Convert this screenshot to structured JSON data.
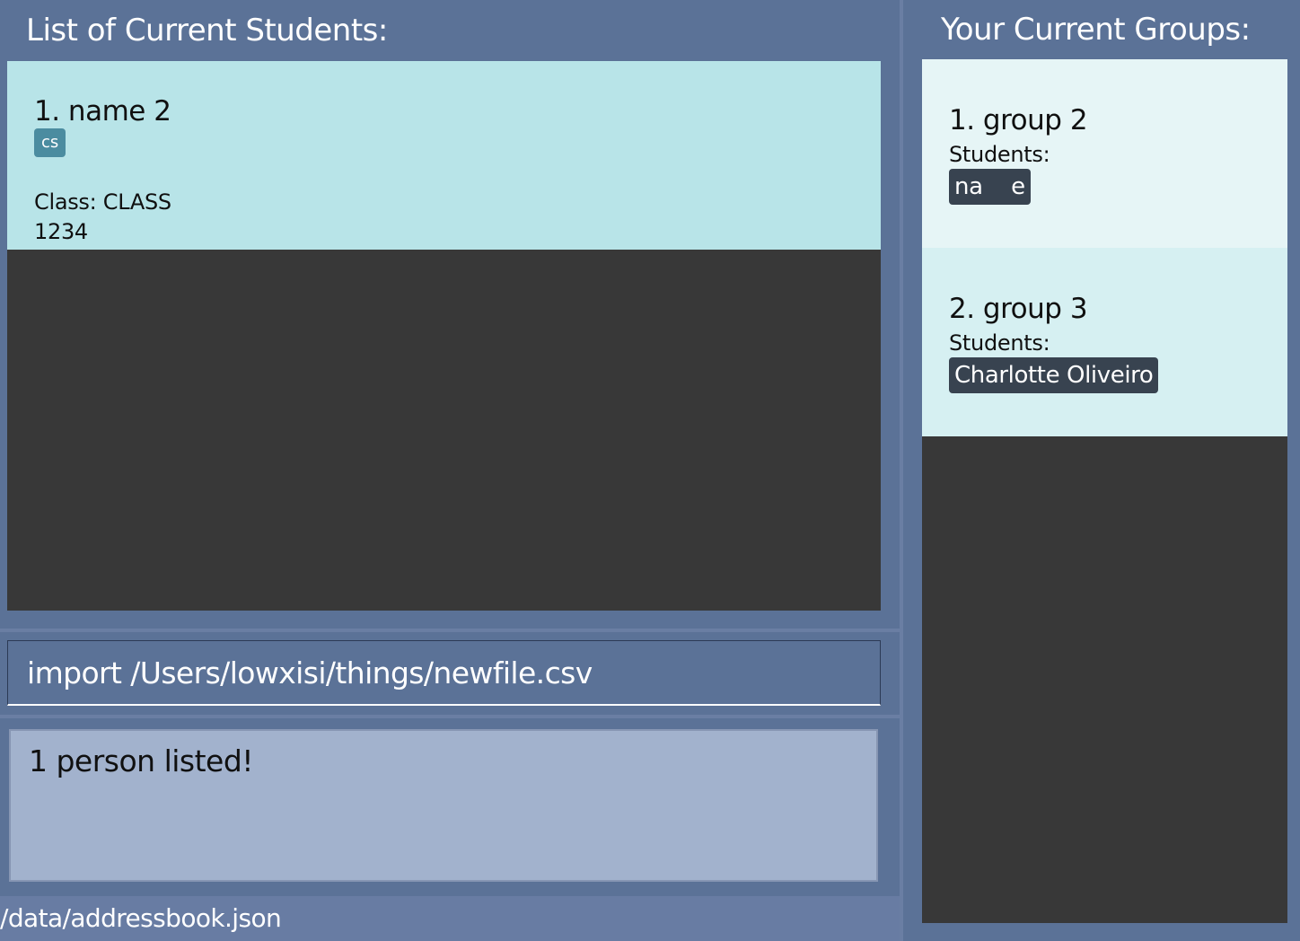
{
  "students_panel": {
    "title": "List of Current Students:",
    "students": [
      {
        "name": "1. name 2",
        "tags": [
          "cs"
        ],
        "phone": "1234",
        "class": "Class: CLASS"
      }
    ]
  },
  "groups_panel": {
    "title": "Your Current Groups:",
    "groups": [
      {
        "name": "1. group 2",
        "students_label": "Students:",
        "members": [
          "na    e"
        ]
      },
      {
        "name": "2. group 3",
        "students_label": "Students:",
        "members": [
          "Charlotte Oliveiro"
        ]
      }
    ]
  },
  "command": {
    "value": "import /Users/lowxisi/things/newfile.csv"
  },
  "result": {
    "message": "1 person listed!"
  },
  "status_bar": {
    "file_path": "/data/addressbook.json"
  },
  "colors": {
    "background": "#5b7297",
    "student_card": "#b8e4e8",
    "group_card_1": "#e6f5f6",
    "group_card_2": "#d6f0f2",
    "tag": "#4b8ca0",
    "member_chip": "#384350",
    "result_box": "#a2b2cd",
    "empty_list": "#383838"
  }
}
